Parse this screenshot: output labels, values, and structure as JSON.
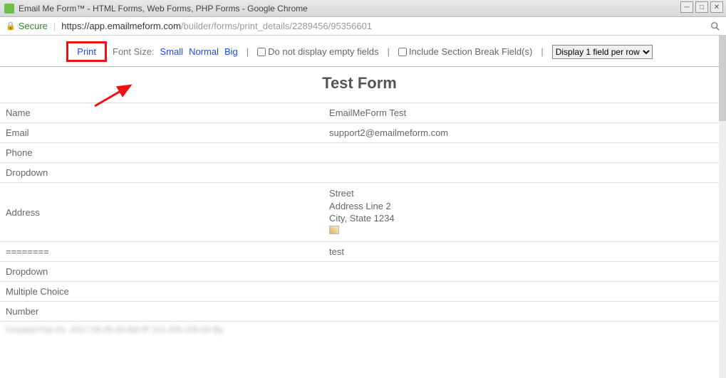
{
  "window": {
    "title": "Email Me Form™ - HTML Forms, Web Forms, PHP Forms - Google Chrome"
  },
  "address": {
    "secure_label": "Secure",
    "url_dark": "https://app.emailmeform.com",
    "url_light": "/builder/forms/print_details/2289456/95356601"
  },
  "toolbar": {
    "print_label": "Print",
    "print_tooltip": "Print",
    "fontsize_label": "Font Size:",
    "size_small": "Small",
    "size_normal": "Normal",
    "size_big": "Big",
    "chk_empty": "Do not display empty fields",
    "chk_section": "Include Section Break Field(s)",
    "select_value": "Display 1 field per row"
  },
  "form": {
    "title": "Test Form",
    "rows": [
      {
        "label": "Name",
        "value": "EmailMeForm Test"
      },
      {
        "label": "Email",
        "value": "support2@emailmeform.com"
      },
      {
        "label": "Phone",
        "value": ""
      },
      {
        "label": "Dropdown",
        "value": ""
      },
      {
        "label": "Address",
        "value": "Street\nAddress Line 2\nCity, State 1234",
        "hasimg": true
      },
      {
        "label": "========",
        "value": "test"
      },
      {
        "label": "Dropdown",
        "value": ""
      },
      {
        "label": "Multiple Choice",
        "value": ""
      },
      {
        "label": "Number",
        "value": ""
      }
    ],
    "footer_blur": "Created Feb 01, 2017 04:25:16 AM IP 112.205.150.54 By"
  }
}
